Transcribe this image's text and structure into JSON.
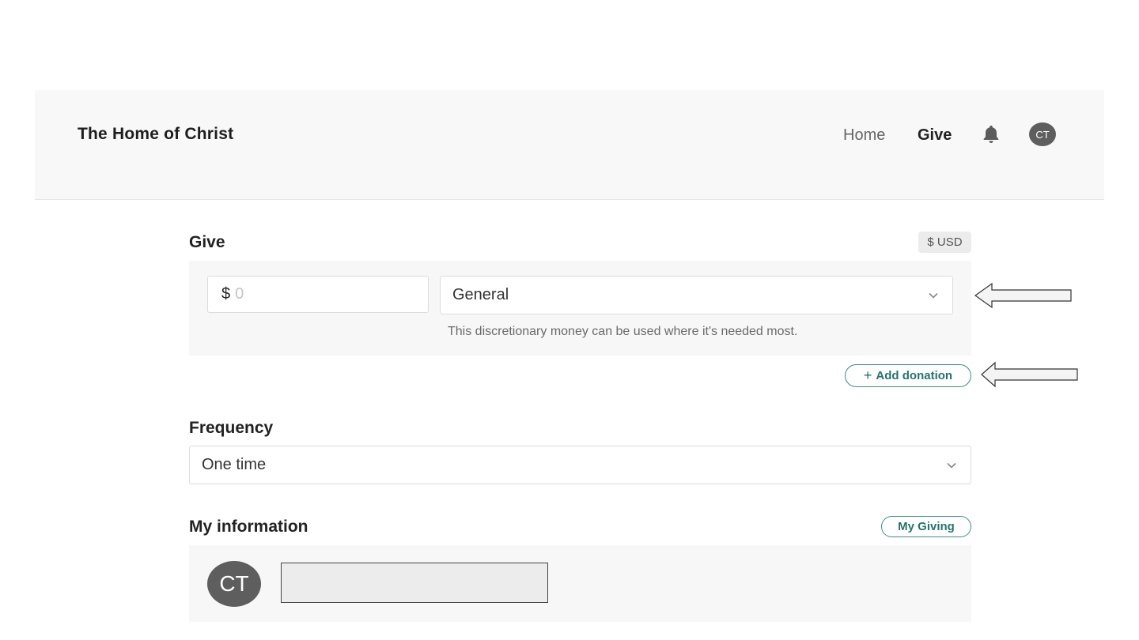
{
  "header": {
    "brand": "The Home of Christ",
    "nav": {
      "home": "Home",
      "give": "Give"
    },
    "bell_icon": "bell-icon",
    "avatar_initials": "CT"
  },
  "give": {
    "title": "Give",
    "currency": "$ USD",
    "amount": {
      "symbol": "$",
      "placeholder": "0",
      "value": ""
    },
    "fund": {
      "selected": "General",
      "description": "This discretionary money can be used where it's needed most."
    },
    "add_donation": {
      "plus": "+",
      "label": "Add donation"
    }
  },
  "frequency": {
    "title": "Frequency",
    "selected": "One time"
  },
  "my_information": {
    "title": "My information",
    "my_giving_label": "My Giving",
    "avatar_initials": "CT"
  },
  "colors": {
    "accent": "#22756c",
    "header_bg": "#f8f8f8",
    "panel_bg": "#f7f7f7",
    "avatar_bg": "#5e5e5e"
  }
}
